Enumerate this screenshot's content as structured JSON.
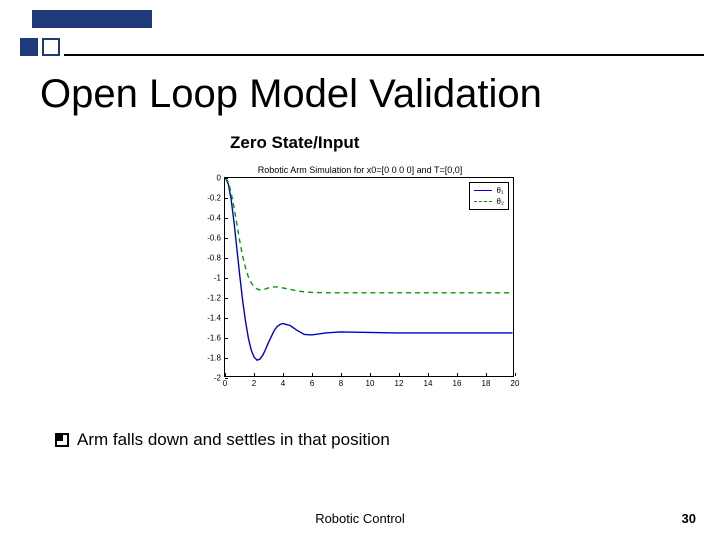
{
  "accent_color": "#1f3a7a",
  "title": "Open Loop Model Validation",
  "subtitle": "Zero State/Input",
  "chart_data": {
    "type": "line",
    "title": "Robotic Arm Simulation for x0=[0 0 0 0] and T=[0,0]",
    "x": [
      0,
      0.2,
      0.4,
      0.6,
      0.8,
      1,
      1.2,
      1.4,
      1.6,
      1.8,
      2,
      2.2,
      2.4,
      2.6,
      2.8,
      3,
      3.2,
      3.4,
      3.6,
      3.8,
      4,
      4.5,
      5,
      5.5,
      6,
      7,
      8,
      10,
      12,
      14,
      16,
      18,
      20
    ],
    "series": [
      {
        "name": "θ₁",
        "color": "#0000cc",
        "style": "solid",
        "values": [
          0,
          -0.06,
          -0.22,
          -0.45,
          -0.72,
          -0.99,
          -1.24,
          -1.45,
          -1.62,
          -1.74,
          -1.81,
          -1.84,
          -1.83,
          -1.79,
          -1.73,
          -1.66,
          -1.6,
          -1.54,
          -1.5,
          -1.48,
          -1.47,
          -1.49,
          -1.54,
          -1.58,
          -1.585,
          -1.565,
          -1.555,
          -1.56,
          -1.565,
          -1.565,
          -1.565,
          -1.565,
          -1.565
        ]
      },
      {
        "name": "θ₂",
        "color": "#009900",
        "style": "dashed",
        "values": [
          0,
          -0.04,
          -0.15,
          -0.3,
          -0.47,
          -0.64,
          -0.79,
          -0.91,
          -1,
          -1.06,
          -1.1,
          -1.12,
          -1.13,
          -1.13,
          -1.12,
          -1.11,
          -1.1,
          -1.1,
          -1.1,
          -1.105,
          -1.11,
          -1.125,
          -1.14,
          -1.15,
          -1.155,
          -1.16,
          -1.16,
          -1.16,
          -1.16,
          -1.16,
          -1.16,
          -1.16,
          -1.16
        ]
      }
    ],
    "xticks": [
      0,
      2,
      4,
      6,
      8,
      10,
      12,
      14,
      16,
      18,
      20
    ],
    "yticks": [
      0,
      -0.2,
      -0.4,
      -0.6,
      -0.8,
      -1,
      -1.2,
      -1.4,
      -1.6,
      -1.8,
      -2
    ],
    "xlim": [
      0,
      20
    ],
    "ylim": [
      -2,
      0
    ]
  },
  "bullet": "Arm falls down and settles in that position",
  "footer": "Robotic Control",
  "page_number": "30"
}
